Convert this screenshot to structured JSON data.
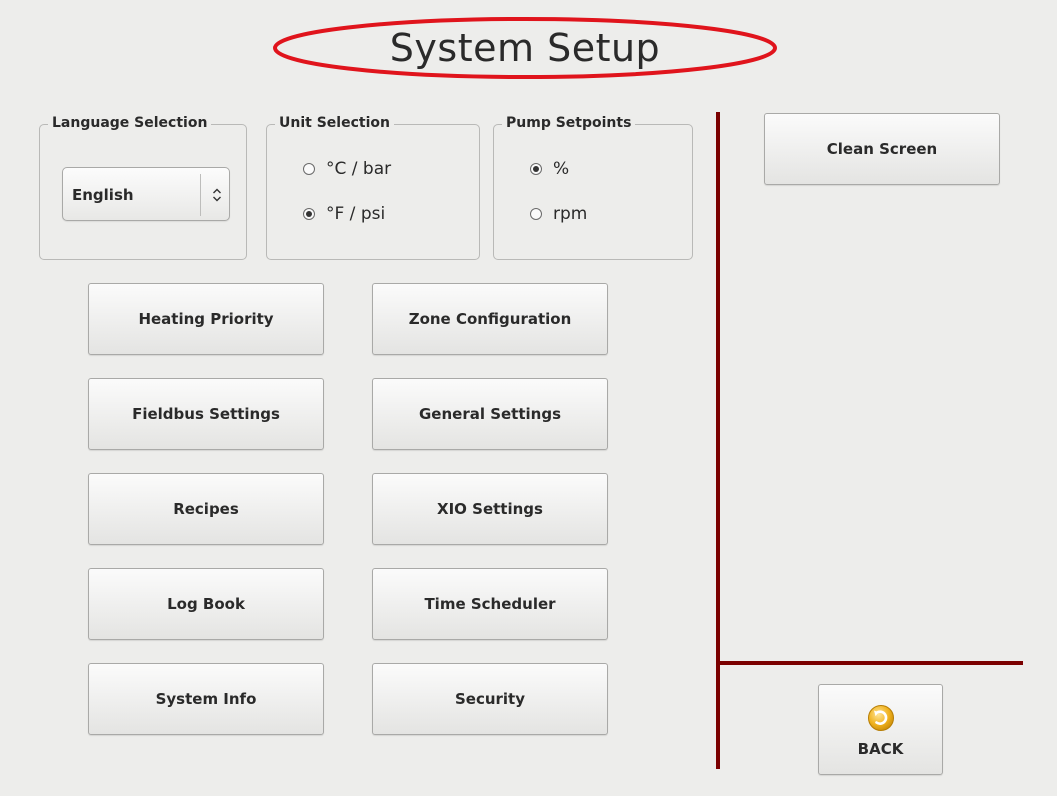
{
  "title": "System Setup",
  "language_selection": {
    "legend": "Language Selection",
    "selected": "English"
  },
  "unit_selection": {
    "legend": "Unit Selection",
    "options": [
      {
        "label": "°C / bar",
        "checked": false
      },
      {
        "label": "°F / psi",
        "checked": true
      }
    ]
  },
  "pump_setpoints": {
    "legend": "Pump Setpoints",
    "options": [
      {
        "label": "%",
        "checked": true
      },
      {
        "label": "rpm",
        "checked": false
      }
    ]
  },
  "buttons": {
    "heating_priority": "Heating Priority",
    "zone_configuration": "Zone Configuration",
    "fieldbus_settings": "Fieldbus Settings",
    "general_settings": "General Settings",
    "recipes": "Recipes",
    "xio_settings": "XIO Settings",
    "log_book": "Log Book",
    "time_scheduler": "Time Scheduler",
    "system_info": "System Info",
    "security": "Security",
    "clean_screen": "Clean Screen",
    "back": "BACK"
  },
  "colors": {
    "divider": "#7a0000",
    "title_ellipse": "#e0141c",
    "back_icon": "#f0b21e"
  },
  "icons": {
    "dropdown": "up-down-chevron-icon",
    "back": "back-arrow-icon"
  }
}
